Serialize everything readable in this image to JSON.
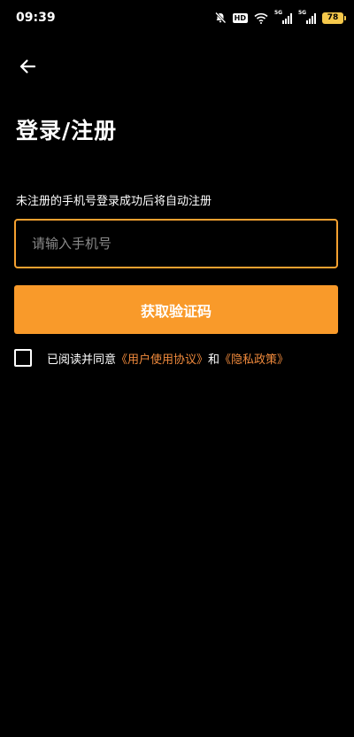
{
  "status_bar": {
    "time": "09:39",
    "hd_label": "HD",
    "signal_1_tag": "5G",
    "signal_2_tag": "5G",
    "battery_level": "78",
    "icons": [
      "mute-icon",
      "hd-icon",
      "wifi-icon",
      "signal-icon",
      "signal-icon",
      "battery-icon"
    ]
  },
  "header": {
    "back_icon": "arrow-left-icon",
    "title": "登录/注册"
  },
  "form": {
    "hint": "未注册的手机号登录成功后将自动注册",
    "phone_placeholder": "请输入手机号",
    "phone_value": "",
    "submit_label": "获取验证码"
  },
  "agreement": {
    "checked": false,
    "prefix": "已阅读并同意",
    "user_agreement_link": "《用户使用协议》",
    "connector": "和",
    "privacy_link": "《隐私政策》"
  },
  "colors": {
    "background": "#000000",
    "accent": "#f99a2a",
    "input_border": "#f5a130",
    "link": "#f08a3c",
    "battery": "#f5c84b"
  }
}
